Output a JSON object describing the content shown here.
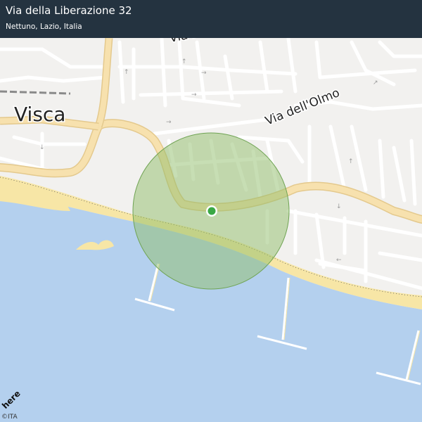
{
  "header": {
    "title": "Via della Liberazione 32",
    "subtitle": "Nettuno, Lazio, Italia"
  },
  "map": {
    "place_labels": {
      "town": "Visca",
      "street_1": "Via  Ponserico",
      "street_2": "Via  dell'Olmo"
    },
    "logo_text": "here",
    "attribution": "©ITA",
    "colors": {
      "land": "#f2f1ef",
      "sea": "#b4d0ee",
      "beach": "#f7e6a6",
      "main_road": "#f7e1ae",
      "road_casing": "#e4c98d",
      "minor_road": "#ffffff",
      "accuracy_circle": "#8fbe6a",
      "location_dot": "#3aa845",
      "header_bg": "#243340"
    },
    "icons": [
      "location-dot-icon",
      "accuracy-circle"
    ]
  }
}
